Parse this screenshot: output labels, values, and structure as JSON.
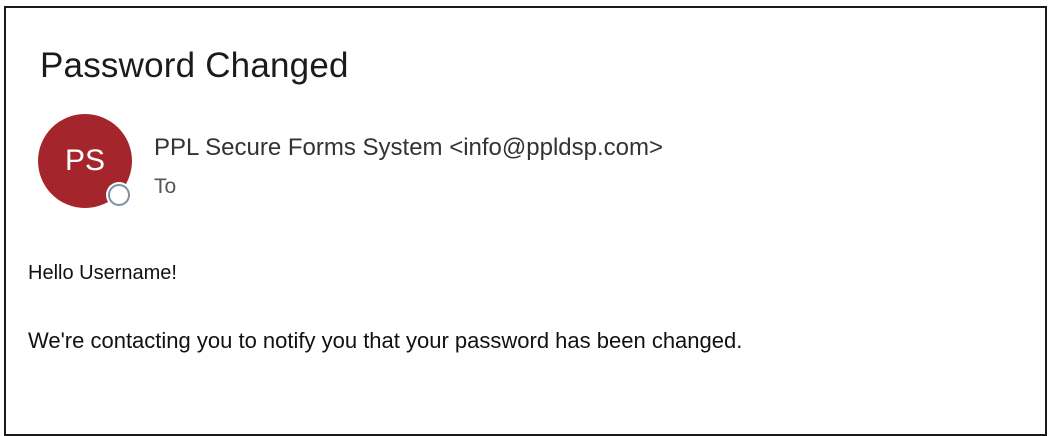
{
  "email": {
    "subject": "Password Changed",
    "avatar_initials": "PS",
    "avatar_color": "#a4262c",
    "sender": "PPL Secure Forms System <info@ppldsp.com>",
    "to_label": "To",
    "greeting": "Hello Username!",
    "body": "We're contacting you to notify you that your password has been changed."
  }
}
